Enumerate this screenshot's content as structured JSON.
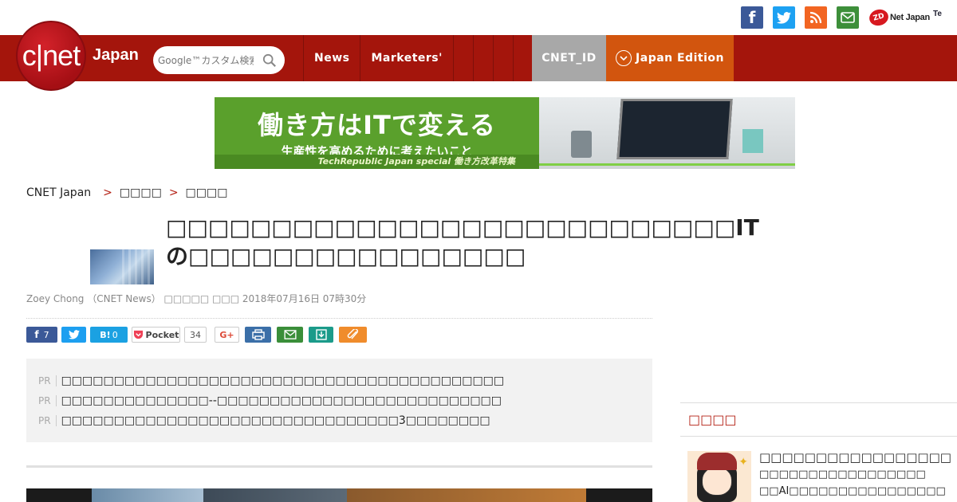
{
  "topbar": {
    "social": [
      "facebook-icon",
      "twitter-icon",
      "rss-icon",
      "mail-icon"
    ],
    "zdnet_badge": "ZD",
    "zdnet_text": "Net Japan",
    "techrepublic_text": "Te"
  },
  "header": {
    "logo_text": "c|net",
    "logo_region": "Japan",
    "search_placeholder": "Google™カスタム検索",
    "nav": [
      "News",
      "Marketers'"
    ],
    "cnet_id": "CNET_ID",
    "edition": "Japan Edition",
    "colors": {
      "nav_bg": "#a4150c",
      "cnet_id_bg": "#a8a8a8",
      "edition_bg": "#d2550e"
    }
  },
  "banner": {
    "headline": "働き方はITで変える",
    "subline": "生産性を高めるために考えたいこと",
    "footer": "TechRepublic Japan special 働き方改革特集"
  },
  "breadcrumb": {
    "root": "CNET Japan",
    "sep": ">",
    "level1": "□□□□",
    "level2": "□□□□"
  },
  "article": {
    "title": "□□□□□□□□□□□□□□□□□□□□□□□□□□□ITの□□□□□□□□□□□□□□□□",
    "byline": "Zoey Chong （CNET News） □□□□□ □□□ 2018年07月16日 07時30分"
  },
  "share": {
    "fb_count": "7",
    "hatena_label": "B!",
    "hatena_count": "0",
    "pocket_label": "Pocket",
    "pocket_count": "34",
    "gplus_label": "G+"
  },
  "pr": {
    "tag": "PR",
    "items": [
      "□□□□□□□□□□□□□□□□□□□□□□□□□□□□□□□□□□□□□□□□□□",
      "□□□□□□□□□□□□□□--□□□□□□□□□□□□□□□□□□□□□□□□□□□",
      "□□□□□□□□□□□□□□□□□□□□□□□□□□□□□□□□3□□□□□□□□"
    ]
  },
  "sidebar": {
    "heading": "□□□□",
    "item": {
      "title": "□□□□□□□□□□□□□□□□□",
      "line1": "□□□□□□□□□□□□□□□□□",
      "line2": "□□AI□□□□□□□□□□□□□□□□"
    }
  }
}
